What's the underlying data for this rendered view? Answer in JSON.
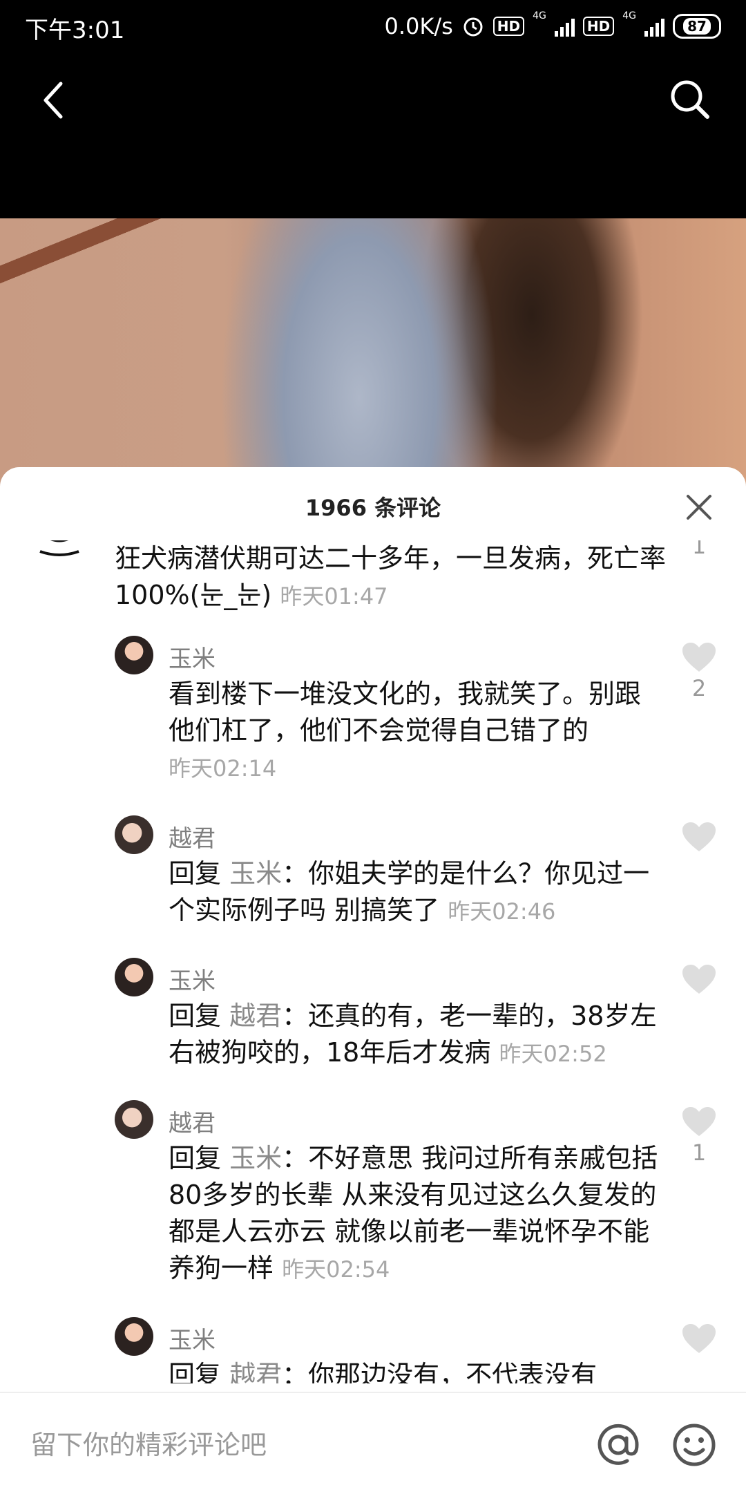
{
  "status_bar": {
    "time": "下午3:01",
    "net_speed": "0.0K/s",
    "hd1": "HD",
    "hd2": "HD",
    "net_type": "4G",
    "battery": "87"
  },
  "comments_header": {
    "title": "1966 条评论"
  },
  "comments": [
    {
      "text": "狂犬病潜伏期可达二十多年，一旦发病，死亡率100%(눈_눈)",
      "time": "昨天01:47",
      "likes": "1"
    },
    {
      "user": "玉米",
      "text": "看到楼下一堆没文化的，我就笑了。别跟他们杠了，他们不会觉得自己错了的",
      "time": "昨天02:14",
      "likes": "2"
    },
    {
      "user": "越君",
      "reply_prefix": "回复 ",
      "reply_to": "玉米",
      "text": "：你姐夫学的是什么？你见过一个实际例子吗 别搞笑了",
      "time": "昨天02:46",
      "likes": ""
    },
    {
      "user": "玉米",
      "reply_prefix": "回复 ",
      "reply_to": "越君",
      "text": "：还真的有，老一辈的，38岁左右被狗咬的，18年后才发病",
      "time": "昨天02:52",
      "likes": ""
    },
    {
      "user": "越君",
      "reply_prefix": "回复 ",
      "reply_to": "玉米",
      "text": "：不好意思 我问过所有亲戚包括80多岁的长辈 从来没有见过这么久复发的 都是人云亦云 就像以前老一辈说怀孕不能养狗一样",
      "time": "昨天02:54",
      "likes": "1"
    },
    {
      "user": "玉米",
      "reply_prefix": "回复 ",
      "reply_to": "越君",
      "text": "：你那边没有，不代表没有",
      "likes": ""
    }
  ],
  "input": {
    "placeholder": "留下你的精彩评论吧"
  },
  "icons": {
    "back": "back-icon",
    "search": "search-icon",
    "close": "close-icon",
    "like": "heart-icon",
    "mention": "at-icon",
    "emoji": "emoji-icon"
  }
}
